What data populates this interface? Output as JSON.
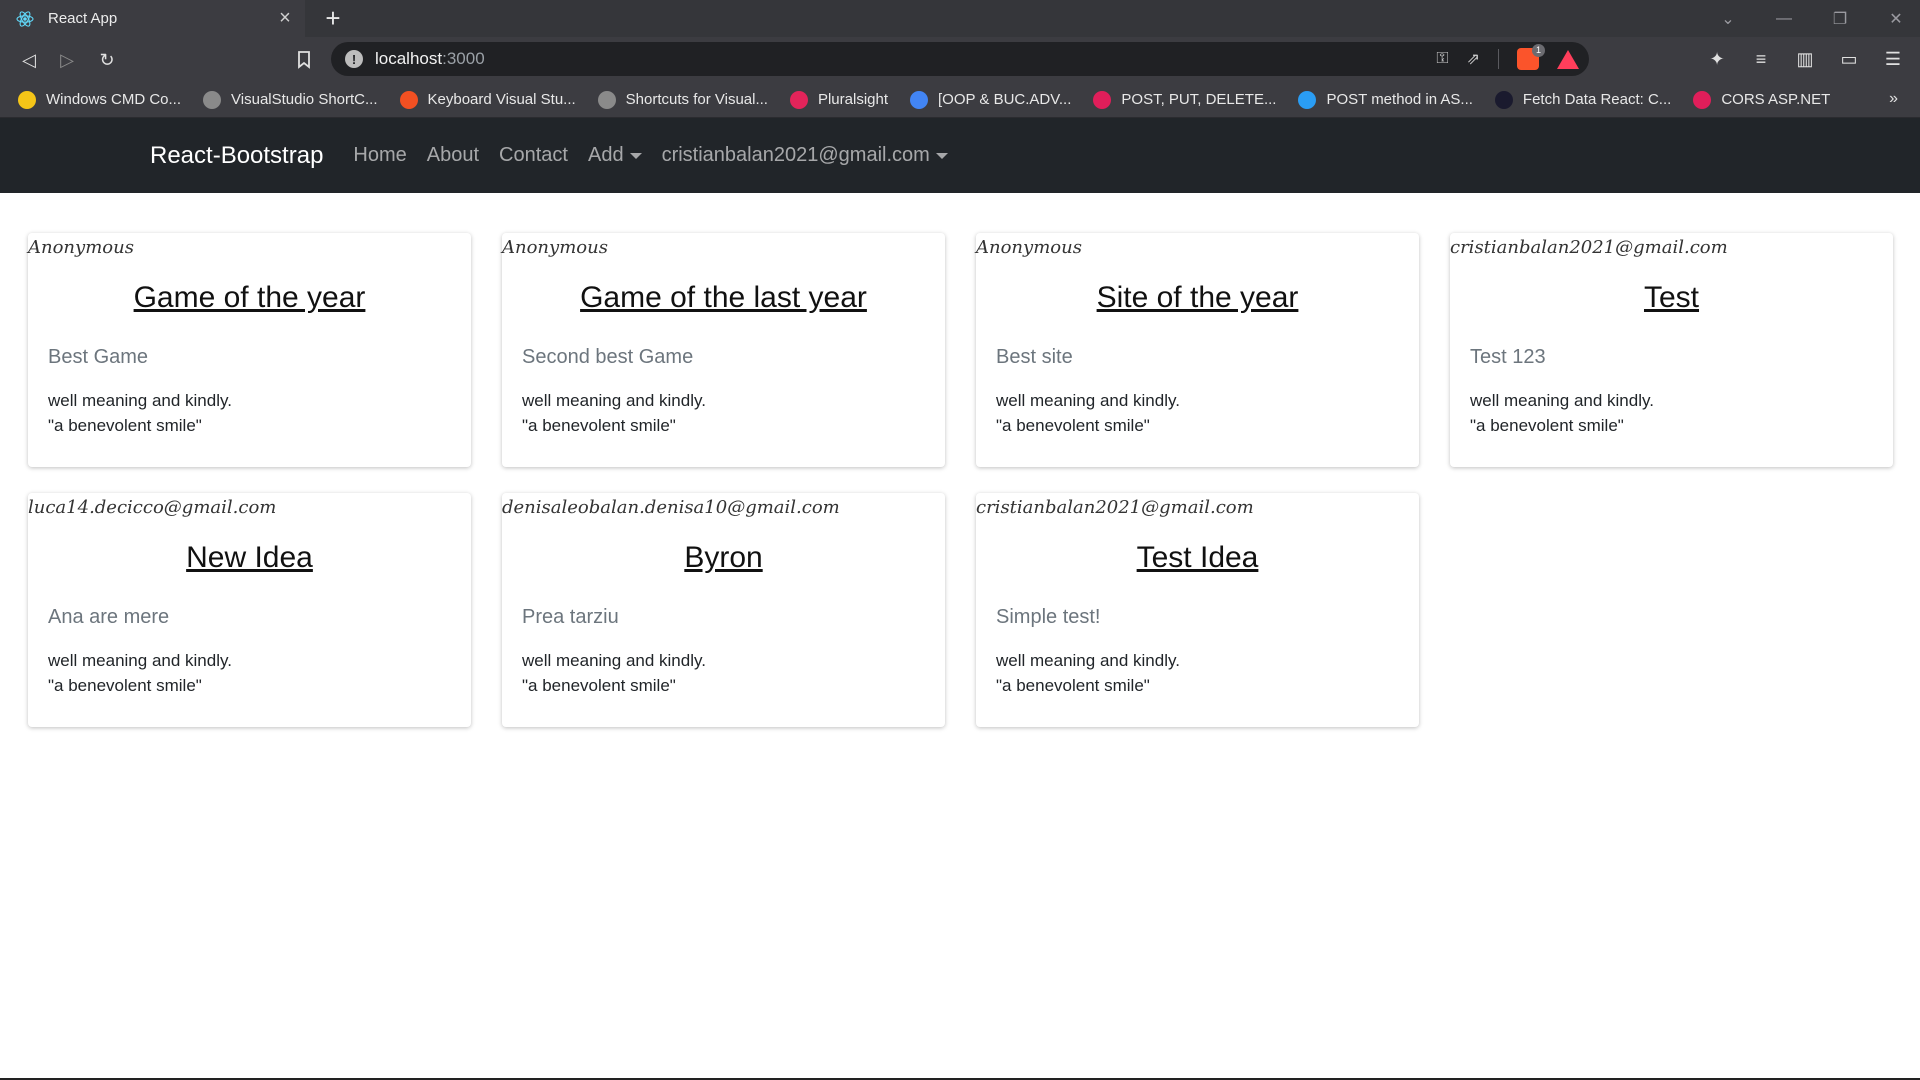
{
  "browser": {
    "tab_title": "React App",
    "tab_close": "×",
    "new_tab": "+",
    "url_host": "localhost",
    "url_port": ":3000",
    "brave_badge": "1",
    "bookmarks": [
      {
        "label": "Windows CMD Co...",
        "color": "#f5c518"
      },
      {
        "label": "VisualStudio ShortC...",
        "color": "#8a8a8a"
      },
      {
        "label": "Keyboard Visual Stu...",
        "color": "#f25022"
      },
      {
        "label": "Shortcuts for Visual...",
        "color": "#8a8a8a"
      },
      {
        "label": "Pluralsight",
        "color": "#e2245a"
      },
      {
        "label": "[OOP & BUC.ADV...",
        "color": "#4285f4"
      },
      {
        "label": "POST, PUT, DELETE...",
        "color": "#e01e5a"
      },
      {
        "label": "POST method in AS...",
        "color": "#2a9df4"
      },
      {
        "label": "Fetch Data React: C...",
        "color": "#1a1a2e"
      },
      {
        "label": "CORS ASP.NET",
        "color": "#e01e5a"
      }
    ],
    "bookmarks_more": "»"
  },
  "navbar": {
    "brand": "React-Bootstrap",
    "links": [
      "Home",
      "About",
      "Contact",
      "Add"
    ],
    "user": "cristianbalan2021@gmail.com"
  },
  "cards": [
    {
      "author": "Anonymous",
      "title": "Game of the year",
      "subtitle": "Best Game",
      "line1": "well meaning and kindly.",
      "line2": "\"a benevolent smile\""
    },
    {
      "author": "Anonymous",
      "title": "Game of the last year",
      "subtitle": "Second best Game",
      "line1": "well meaning and kindly.",
      "line2": "\"a benevolent smile\""
    },
    {
      "author": "Anonymous",
      "title": "Site of the year",
      "subtitle": "Best site",
      "line1": "well meaning and kindly.",
      "line2": "\"a benevolent smile\""
    },
    {
      "author": "cristianbalan2021@gmail.com",
      "title": "Test",
      "subtitle": "Test 123",
      "line1": "well meaning and kindly.",
      "line2": "\"a benevolent smile\""
    },
    {
      "author": "luca14.decicco@gmail.com",
      "title": "New Idea",
      "subtitle": "Ana are mere",
      "line1": "well meaning and kindly.",
      "line2": "\"a benevolent smile\""
    },
    {
      "author": "denisaleobalan.denisa10@gmail.com",
      "title": "Byron",
      "subtitle": "Prea tarziu",
      "line1": "well meaning and kindly.",
      "line2": "\"a benevolent smile\""
    },
    {
      "author": "cristianbalan2021@gmail.com",
      "title": "Test Idea",
      "subtitle": "Simple test!",
      "line1": "well meaning and kindly.",
      "line2": "\"a benevolent smile\""
    }
  ]
}
